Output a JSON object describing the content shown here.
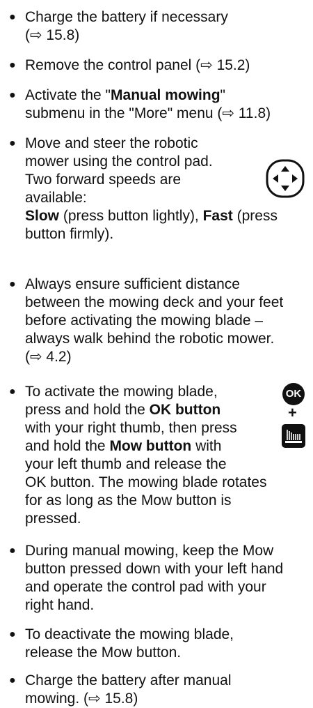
{
  "bullet_char": "●",
  "arrow": "⇨",
  "items": [
    {
      "lines": [
        "Charge the battery if necessary",
        "(⇨ 15.8)"
      ]
    },
    {
      "lines": [
        "Remove the control panel (⇨ 15.2)"
      ]
    },
    {
      "pre": "Activate the \"",
      "bold": "Manual mowing",
      "post": "\"",
      "line2": "submenu in the \"More\" menu (⇨ 11.8)"
    },
    {
      "lines": [
        "Move and steer the robotic",
        "mower using the control pad.",
        "Two forward speeds are",
        "available:"
      ],
      "slow_label": "Slow",
      "slow_text": " (press button lightly), ",
      "fast_label": "Fast",
      "fast_text": " (press",
      "last_line": "button firmly)."
    },
    {
      "lines": [
        "Always ensure sufficient distance",
        "between the mowing deck and your feet",
        "before activating the mowing blade –",
        "always walk behind the robotic mower.",
        "(⇨ 4.2)"
      ]
    },
    {
      "l1": "To activate the mowing blade,",
      "l2a": "press and hold the ",
      "l2b": "OK button",
      "l3": "with your right thumb, then press",
      "l4a": "and hold the ",
      "l4b": "Mow button",
      "l4c": " with",
      "l5": "your left thumb and release the",
      "l6": "OK button. The mowing blade rotates",
      "l7": "for as long as the Mow button is",
      "l8": "pressed.",
      "ok_icon_label": "OK",
      "plus": "+"
    },
    {
      "lines": [
        "During manual mowing, keep the Mow",
        "button pressed down with your left hand",
        "and operate the control pad with your",
        "right hand."
      ]
    },
    {
      "lines": [
        "To deactivate the mowing blade,",
        "release the Mow button."
      ]
    },
    {
      "lines": [
        "Charge the battery after manual",
        "mowing. (⇨ 15.8)"
      ]
    }
  ]
}
